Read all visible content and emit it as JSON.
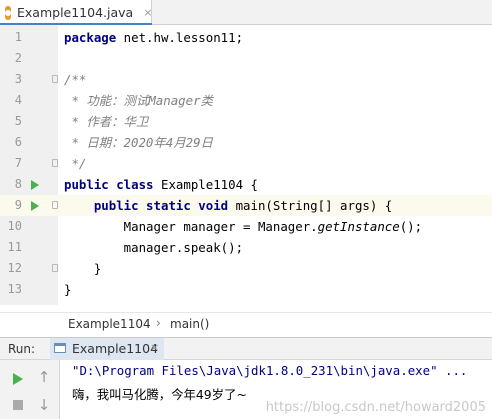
{
  "editor_tab": {
    "filename": "Example1104.java",
    "close": "×"
  },
  "code_lines": [
    {
      "n": "1",
      "text": "package net.hw.lesson11;"
    },
    {
      "n": "2",
      "text": ""
    },
    {
      "n": "3",
      "text": "/**"
    },
    {
      "n": "4",
      "text": " * 功能：测试Manager类"
    },
    {
      "n": "5",
      "text": " * 作者：华卫"
    },
    {
      "n": "6",
      "text": " * 日期：2020年4月29日"
    },
    {
      "n": "7",
      "text": " */"
    },
    {
      "n": "8",
      "kw": "public class",
      "rest": " Example1104 {"
    },
    {
      "n": "9",
      "pre": "    ",
      "kw": "public static void",
      "rest": " main(String[] args) {"
    },
    {
      "n": "10",
      "pre": "        Manager manager = Manager.",
      "mi": "getInstance",
      "post": "();"
    },
    {
      "n": "11",
      "text": "        manager.speak();"
    },
    {
      "n": "12",
      "text": "    }"
    },
    {
      "n": "13",
      "text": "}"
    }
  ],
  "breadcrumb": {
    "class": "Example1104",
    "separator": "›",
    "method": "main()"
  },
  "run_panel": {
    "label": "Run:",
    "tab": "Example1104",
    "tab_close": "×",
    "command": "\"D:\\Program Files\\Java\\jdk1.8.0_231\\bin\\java.exe\" ...",
    "output": "嗨，我叫马化腾，今年49岁了~",
    "up_arrow": "↑",
    "down_arrow": "↓"
  },
  "watermark": "https://blog.csdn.net/howard2005",
  "colors": {
    "keyword": "#000080",
    "comment": "#808080",
    "run_green": "#4caf50",
    "accent": "#4083c9"
  }
}
